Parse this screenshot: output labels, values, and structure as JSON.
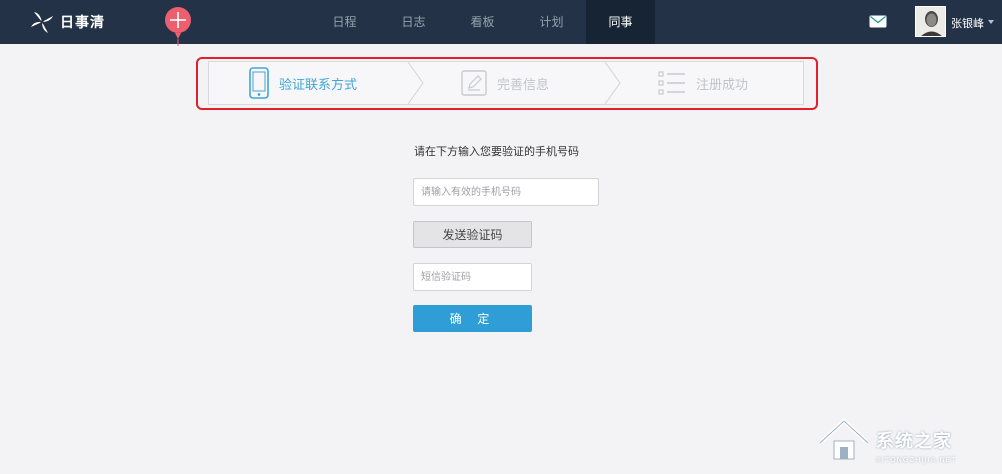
{
  "app": {
    "logo_text": "日事清"
  },
  "nav": {
    "items": [
      {
        "label": "日程"
      },
      {
        "label": "日志"
      },
      {
        "label": "看板"
      },
      {
        "label": "计划"
      },
      {
        "label": "同事"
      }
    ],
    "active_index": 4
  },
  "user": {
    "name": "张银峰"
  },
  "steps": {
    "items": [
      {
        "label": "验证联系方式",
        "icon": "phone-icon",
        "state": "active"
      },
      {
        "label": "完善信息",
        "icon": "edit-icon",
        "state": "inactive"
      },
      {
        "label": "注册成功",
        "icon": "list-icon",
        "state": "inactive"
      }
    ]
  },
  "form": {
    "instruction": "请在下方输入您要验证的手机号码",
    "phone_placeholder": "请输入有效的手机号码",
    "phone_value": "",
    "send_code_label": "发送验证码",
    "code_placeholder": "短信验证码",
    "code_value": "",
    "confirm_label": "确 定"
  },
  "watermark": {
    "text": "系统之家",
    "subtext": "XITONGZHIJIA.NET"
  },
  "colors": {
    "topbar": "#233246",
    "nav_active": "#172434",
    "accent": "#2f9ed6",
    "highlight_border": "#e0202a",
    "balloon": "#ec5f6e"
  }
}
